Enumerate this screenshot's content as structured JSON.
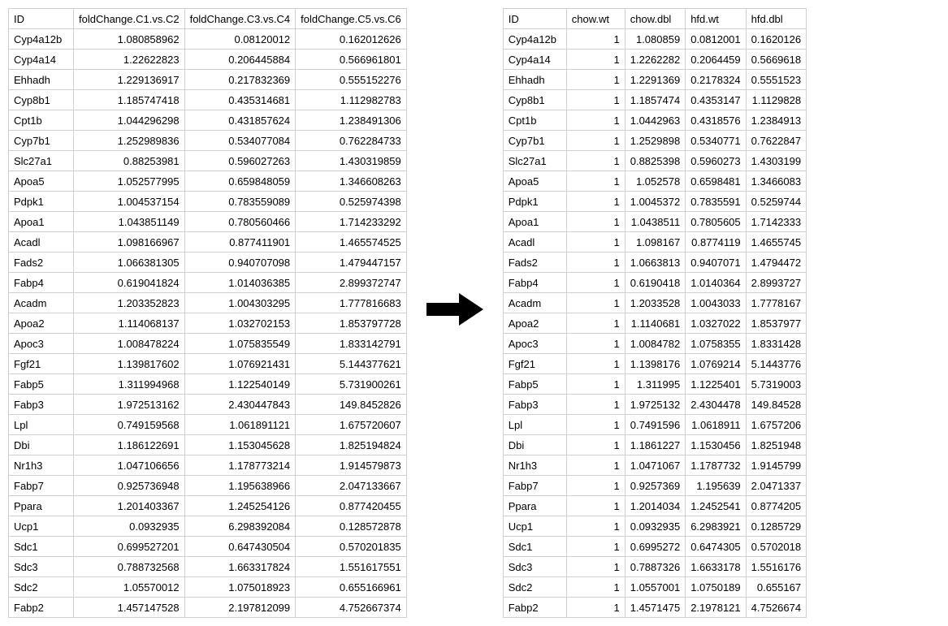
{
  "left": {
    "headers": [
      "ID",
      "foldChange.C1.vs.C2",
      "foldChange.C3.vs.C4",
      "foldChange.C5.vs.C6"
    ],
    "rows": [
      [
        "Cyp4a12b",
        "1.080858962",
        "0.08120012",
        "0.162012626"
      ],
      [
        "Cyp4a14",
        "1.22622823",
        "0.206445884",
        "0.566961801"
      ],
      [
        "Ehhadh",
        "1.229136917",
        "0.217832369",
        "0.555152276"
      ],
      [
        "Cyp8b1",
        "1.185747418",
        "0.435314681",
        "1.112982783"
      ],
      [
        "Cpt1b",
        "1.044296298",
        "0.431857624",
        "1.238491306"
      ],
      [
        "Cyp7b1",
        "1.252989836",
        "0.534077084",
        "0.762284733"
      ],
      [
        "Slc27a1",
        "0.88253981",
        "0.596027263",
        "1.430319859"
      ],
      [
        "Apoa5",
        "1.052577995",
        "0.659848059",
        "1.346608263"
      ],
      [
        "Pdpk1",
        "1.004537154",
        "0.783559089",
        "0.525974398"
      ],
      [
        "Apoa1",
        "1.043851149",
        "0.780560466",
        "1.714233292"
      ],
      [
        "Acadl",
        "1.098166967",
        "0.877411901",
        "1.465574525"
      ],
      [
        "Fads2",
        "1.066381305",
        "0.940707098",
        "1.479447157"
      ],
      [
        "Fabp4",
        "0.619041824",
        "1.014036385",
        "2.899372747"
      ],
      [
        "Acadm",
        "1.203352823",
        "1.004303295",
        "1.777816683"
      ],
      [
        "Apoa2",
        "1.114068137",
        "1.032702153",
        "1.853797728"
      ],
      [
        "Apoc3",
        "1.008478224",
        "1.075835549",
        "1.833142791"
      ],
      [
        "Fgf21",
        "1.139817602",
        "1.076921431",
        "5.144377621"
      ],
      [
        "Fabp5",
        "1.311994968",
        "1.122540149",
        "5.731900261"
      ],
      [
        "Fabp3",
        "1.972513162",
        "2.430447843",
        "149.8452826"
      ],
      [
        "Lpl",
        "0.749159568",
        "1.061891121",
        "1.675720607"
      ],
      [
        "Dbi",
        "1.186122691",
        "1.153045628",
        "1.825194824"
      ],
      [
        "Nr1h3",
        "1.047106656",
        "1.178773214",
        "1.914579873"
      ],
      [
        "Fabp7",
        "0.925736948",
        "1.195638966",
        "2.047133667"
      ],
      [
        "Ppara",
        "1.201403367",
        "1.245254126",
        "0.877420455"
      ],
      [
        "Ucp1",
        "0.0932935",
        "6.298392084",
        "0.128572878"
      ],
      [
        "Sdc1",
        "0.699527201",
        "0.647430504",
        "0.570201835"
      ],
      [
        "Sdc3",
        "0.788732568",
        "1.663317824",
        "1.551617551"
      ],
      [
        "Sdc2",
        "1.05570012",
        "1.075018923",
        "0.655166961"
      ],
      [
        "Fabp2",
        "1.457147528",
        "2.197812099",
        "4.752667374"
      ]
    ]
  },
  "right": {
    "headers": [
      "ID",
      "chow.wt",
      "chow.dbl",
      "hfd.wt",
      "hfd.dbl"
    ],
    "rows": [
      [
        "Cyp4a12b",
        "1",
        "1.080859",
        "0.0812001",
        "0.1620126"
      ],
      [
        "Cyp4a14",
        "1",
        "1.2262282",
        "0.2064459",
        "0.5669618"
      ],
      [
        "Ehhadh",
        "1",
        "1.2291369",
        "0.2178324",
        "0.5551523"
      ],
      [
        "Cyp8b1",
        "1",
        "1.1857474",
        "0.4353147",
        "1.1129828"
      ],
      [
        "Cpt1b",
        "1",
        "1.0442963",
        "0.4318576",
        "1.2384913"
      ],
      [
        "Cyp7b1",
        "1",
        "1.2529898",
        "0.5340771",
        "0.7622847"
      ],
      [
        "Slc27a1",
        "1",
        "0.8825398",
        "0.5960273",
        "1.4303199"
      ],
      [
        "Apoa5",
        "1",
        "1.052578",
        "0.6598481",
        "1.3466083"
      ],
      [
        "Pdpk1",
        "1",
        "1.0045372",
        "0.7835591",
        "0.5259744"
      ],
      [
        "Apoa1",
        "1",
        "1.0438511",
        "0.7805605",
        "1.7142333"
      ],
      [
        "Acadl",
        "1",
        "1.098167",
        "0.8774119",
        "1.4655745"
      ],
      [
        "Fads2",
        "1",
        "1.0663813",
        "0.9407071",
        "1.4794472"
      ],
      [
        "Fabp4",
        "1",
        "0.6190418",
        "1.0140364",
        "2.8993727"
      ],
      [
        "Acadm",
        "1",
        "1.2033528",
        "1.0043033",
        "1.7778167"
      ],
      [
        "Apoa2",
        "1",
        "1.1140681",
        "1.0327022",
        "1.8537977"
      ],
      [
        "Apoc3",
        "1",
        "1.0084782",
        "1.0758355",
        "1.8331428"
      ],
      [
        "Fgf21",
        "1",
        "1.1398176",
        "1.0769214",
        "5.1443776"
      ],
      [
        "Fabp5",
        "1",
        "1.311995",
        "1.1225401",
        "5.7319003"
      ],
      [
        "Fabp3",
        "1",
        "1.9725132",
        "2.4304478",
        "149.84528"
      ],
      [
        "Lpl",
        "1",
        "0.7491596",
        "1.0618911",
        "1.6757206"
      ],
      [
        "Dbi",
        "1",
        "1.1861227",
        "1.1530456",
        "1.8251948"
      ],
      [
        "Nr1h3",
        "1",
        "1.0471067",
        "1.1787732",
        "1.9145799"
      ],
      [
        "Fabp7",
        "1",
        "0.9257369",
        "1.195639",
        "2.0471337"
      ],
      [
        "Ppara",
        "1",
        "1.2014034",
        "1.2452541",
        "0.8774205"
      ],
      [
        "Ucp1",
        "1",
        "0.0932935",
        "6.2983921",
        "0.1285729"
      ],
      [
        "Sdc1",
        "1",
        "0.6995272",
        "0.6474305",
        "0.5702018"
      ],
      [
        "Sdc3",
        "1",
        "0.7887326",
        "1.6633178",
        "1.5516176"
      ],
      [
        "Sdc2",
        "1",
        "1.0557001",
        "1.0750189",
        "0.655167"
      ],
      [
        "Fabp2",
        "1",
        "1.4571475",
        "2.1978121",
        "4.7526674"
      ]
    ]
  },
  "arrow_glyph": "➡"
}
